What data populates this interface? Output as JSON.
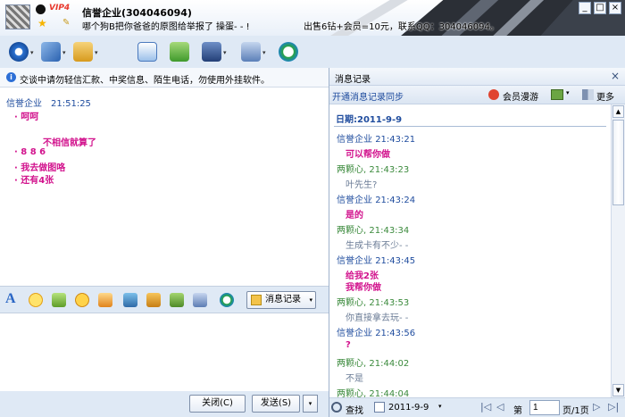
{
  "header": {
    "vip_badge": "VIP4",
    "contact_name": "信誉企业(304046094)",
    "signature": "哪个狗B把你爸爸的原图给举报了  操蛋- - !",
    "ad_text": "出售6钻+会员=10元，联系QQ：304046094。"
  },
  "window": {
    "minimize": "_",
    "maximize": "□",
    "close": "×"
  },
  "toolbar": {
    "dropdown": "▾"
  },
  "warning": {
    "icon": "i",
    "text": "交谈中请勿轻信汇款、中奖信息、陌生电话，勿使用外挂软件。"
  },
  "chat": {
    "sender": "信誉企业",
    "time": "21:51:25",
    "lines": [
      "· 呵呵",
      "不相信就算了",
      "· 8 8 6",
      "· 我去做图咯",
      "· 还有4张"
    ]
  },
  "format": {
    "font_icon": "A",
    "msg_record_label": "消息记录",
    "dropdown": "▾"
  },
  "buttons": {
    "close": "关闭(C)",
    "send": "发送(S)",
    "send_dropdown": "▾"
  },
  "history": {
    "title": "消息记录",
    "close": "×",
    "sync_link": "开通消息记录同步",
    "member_roam": "会员漫游",
    "more": "更多",
    "date": "日期:2011-9-9",
    "entries": [
      {
        "sender": "信誉企业",
        "time": "21:43:21",
        "text": "可以帮你做"
      },
      {
        "sender": "两颗心",
        "time": "21:43:23",
        "text": "叶先生?"
      },
      {
        "sender": "信誉企业",
        "time": "21:43:24",
        "text": "是的"
      },
      {
        "sender": "两颗心",
        "time": "21:43:34",
        "text": "生成卡有不少- -"
      },
      {
        "sender": "信誉企业",
        "time": "21:43:45",
        "text": "给我2张"
      },
      {
        "text": "我帮你做"
      },
      {
        "sender": "两颗心",
        "time": "21:43:53",
        "text": "你直接拿去玩- -"
      },
      {
        "sender": "信誉企业",
        "time": "21:43:56",
        "text": "?"
      },
      {
        "sender": "两颗心",
        "time": "21:44:02",
        "text": "不是"
      },
      {
        "sender": "两颗心",
        "time": "21:44:04",
        "text": ""
      }
    ],
    "footer": {
      "search": "查找",
      "date": "2011-9-9",
      "page_label": "第",
      "page": "1",
      "total": "页/1页",
      "first": "|◁",
      "prev": "◁",
      "next": "▷",
      "last": "▷|"
    }
  }
}
